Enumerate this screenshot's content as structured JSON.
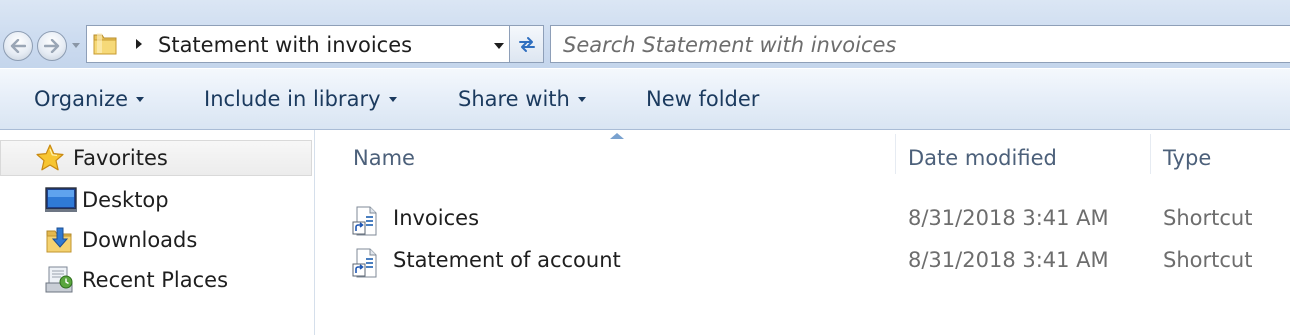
{
  "address_bar": {
    "folder_icon": "folder-icon",
    "path": "Statement with invoices"
  },
  "search": {
    "placeholder": "Search Statement with invoices"
  },
  "command_bar": {
    "organize": "Organize",
    "include_in_library": "Include in library",
    "share_with": "Share with",
    "new_folder": "New folder"
  },
  "navigation": {
    "favorites": {
      "label": "Favorites",
      "icon": "star-icon"
    },
    "items": [
      {
        "label": "Desktop",
        "icon": "desktop-icon"
      },
      {
        "label": "Downloads",
        "icon": "downloads-folder-icon"
      },
      {
        "label": "Recent Places",
        "icon": "recent-places-icon"
      }
    ]
  },
  "file_list": {
    "columns": {
      "name": "Name",
      "date_modified": "Date modified",
      "type": "Type"
    },
    "sorted_by": "Name",
    "rows": [
      {
        "name": "Invoices",
        "date_modified": "8/31/2018 3:41 AM",
        "type": "Shortcut",
        "icon": "shortcut-icon"
      },
      {
        "name": "Statement of account",
        "date_modified": "8/31/2018 3:41 AM",
        "type": "Shortcut",
        "icon": "shortcut-icon"
      }
    ]
  },
  "colors": {
    "nav_bar_bg": "#cddcf0",
    "command_bar_bg": "#e6eef8",
    "command_text": "#1b3a5e",
    "column_header_text": "#4c607a",
    "secondary_text": "#6d6d6d"
  }
}
